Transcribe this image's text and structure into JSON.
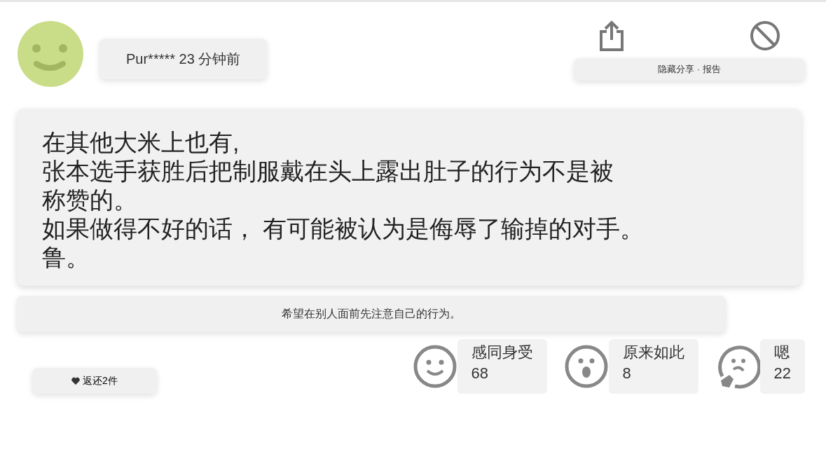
{
  "author": {
    "name": "Pur*****",
    "time": "23 分钟前"
  },
  "actions_label": "隐藏分享 · 报告",
  "comment": {
    "lines": [
      "在其他大米上也有,",
      "张本选手获胜后把制服戴在头上露出肚子的行为不是被",
      "称赞的。",
      "如果做得不好的话， 有可能被认为是侮辱了输掉的对手。",
      "鲁。"
    ]
  },
  "quote": "希望在别人面前先注意自己的行为。",
  "replies_button": "返还2件",
  "reactions": [
    {
      "kind": "smile",
      "label": "感同身受",
      "count": "68"
    },
    {
      "kind": "surprised",
      "label": "原来如此",
      "count": "8"
    },
    {
      "kind": "thinking",
      "label": "嗯",
      "count": "22"
    }
  ]
}
